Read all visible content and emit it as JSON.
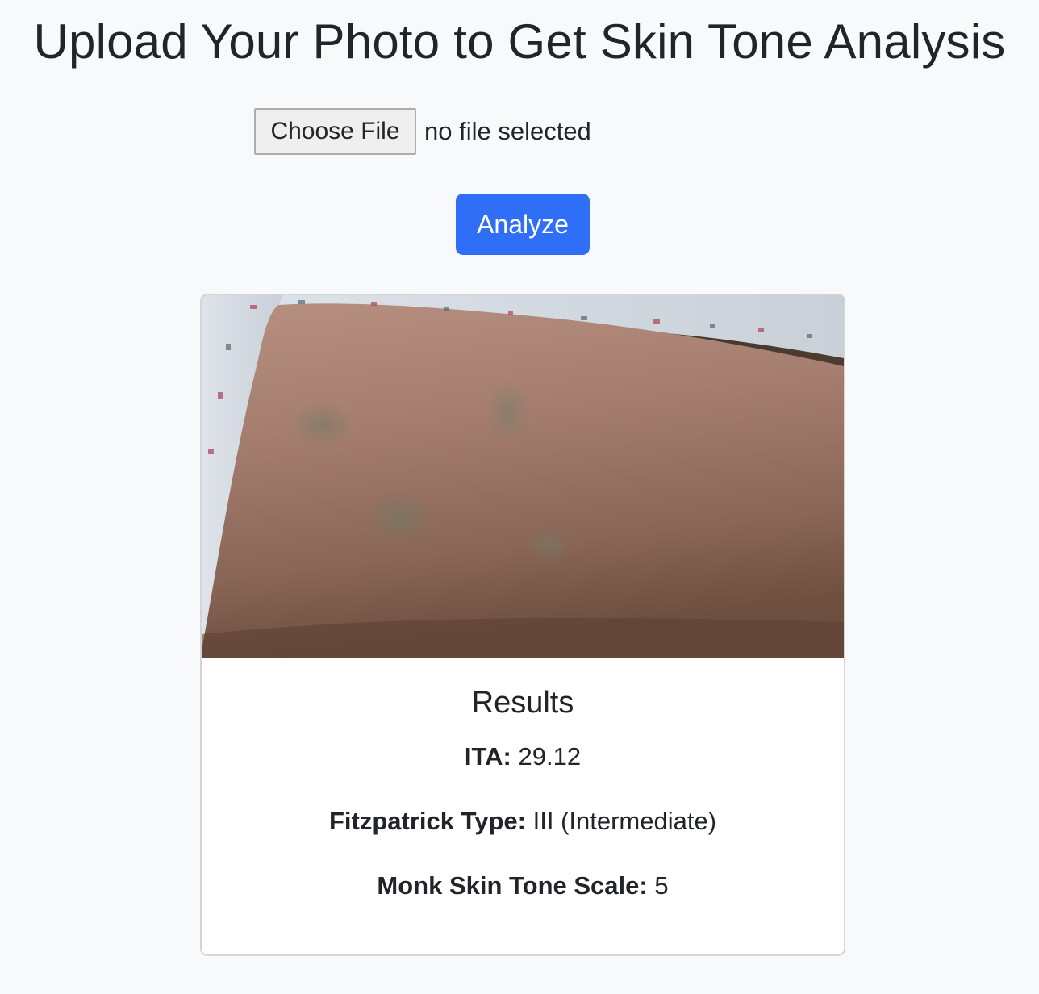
{
  "page": {
    "title": "Upload Your Photo to Get Skin Tone Analysis"
  },
  "upload": {
    "choose_file_label": "Choose File",
    "file_status": "no file selected"
  },
  "actions": {
    "analyze_label": "Analyze"
  },
  "results": {
    "heading": "Results",
    "ita_label": "ITA:",
    "ita_value": "29.12",
    "fitzpatrick_label": "Fitzpatrick Type:",
    "fitzpatrick_value": "III (Intermediate)",
    "monk_label": "Monk Skin Tone Scale:",
    "monk_value": "5"
  },
  "colors": {
    "background": "#f8f9fa",
    "accent": "#2f6ef7",
    "text": "#212529",
    "card_border": "#d3d6d9"
  }
}
